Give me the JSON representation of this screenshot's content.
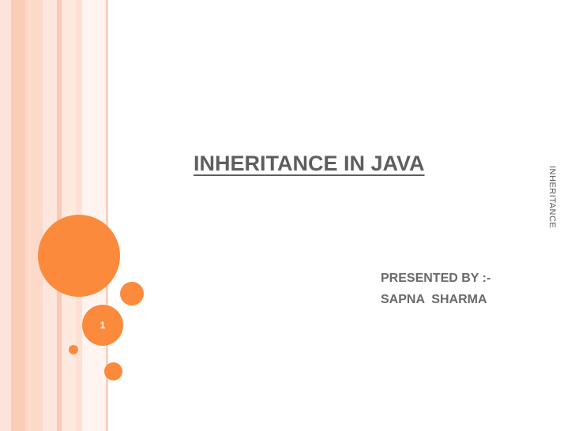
{
  "slide": {
    "title": "INHERITANCE IN JAVA",
    "presenter_line": "PRESENTED BY :-",
    "presenter_name": "SAPNA  SHARMA",
    "side_label": "INHERITANCE",
    "slide_number": "1"
  },
  "colors": {
    "accent_orange": "#fb8a3c",
    "title_gray": "#5e5e5e",
    "stripe_pink": "#fbcdb9"
  }
}
